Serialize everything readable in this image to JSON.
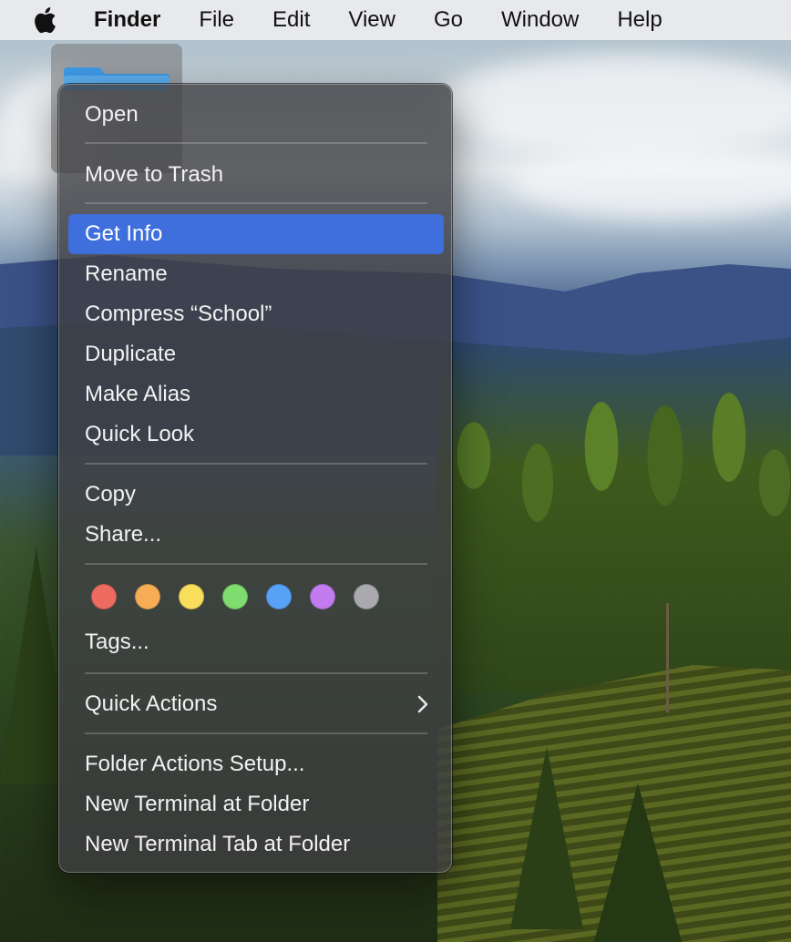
{
  "menubar": {
    "app_name": "Finder",
    "items": [
      "File",
      "Edit",
      "View",
      "Go",
      "Window",
      "Help"
    ]
  },
  "desktop": {
    "selected_folder_icon": "folder-icon"
  },
  "context_menu": {
    "items": {
      "open": "Open",
      "move_to_trash": "Move to Trash",
      "get_info": "Get Info",
      "rename": "Rename",
      "compress": "Compress “School”",
      "duplicate": "Duplicate",
      "make_alias": "Make Alias",
      "quick_look": "Quick Look",
      "copy": "Copy",
      "share": "Share...",
      "tags": "Tags...",
      "quick_actions": "Quick Actions",
      "folder_actions_setup": "Folder Actions Setup...",
      "new_terminal_at_folder": "New Terminal at Folder",
      "new_terminal_tab_at_folder": "New Terminal Tab at Folder"
    },
    "selected_item": "Get Info",
    "tag_colors": [
      {
        "name": "red",
        "hex": "#ee6b60"
      },
      {
        "name": "orange",
        "hex": "#f6ad55"
      },
      {
        "name": "yellow",
        "hex": "#f8de5a"
      },
      {
        "name": "green",
        "hex": "#7fdc6e"
      },
      {
        "name": "blue",
        "hex": "#57a2f6"
      },
      {
        "name": "purple",
        "hex": "#c27cf0"
      },
      {
        "name": "gray",
        "hex": "#a9a9ae"
      }
    ],
    "highlight_color": "#3e6fdc"
  }
}
